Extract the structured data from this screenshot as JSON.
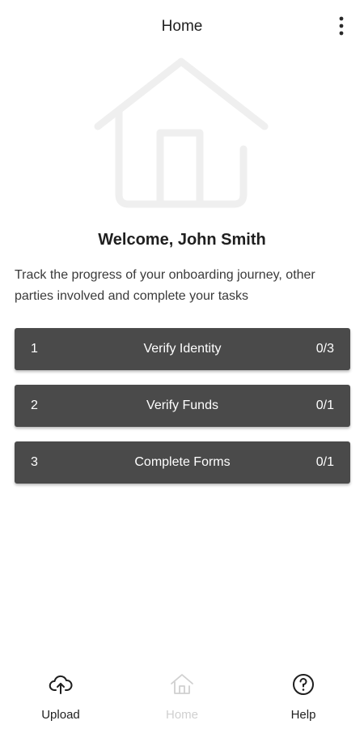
{
  "app_bar": {
    "title": "Home",
    "more_icon": "more-vertical-icon"
  },
  "hero": {
    "icon": "house-outline-icon"
  },
  "welcome": {
    "heading": "Welcome, John Smith",
    "intro": "Track the progress of your onboarding journey, other parties involved and complete your tasks"
  },
  "steps": [
    {
      "number": "1",
      "label": "Verify Identity",
      "count": "0/3"
    },
    {
      "number": "2",
      "label": "Verify Funds",
      "count": "0/1"
    },
    {
      "number": "3",
      "label": "Complete Forms",
      "count": "0/1"
    }
  ],
  "bottom_nav": [
    {
      "label": "Upload",
      "icon": "cloud-upload-icon"
    },
    {
      "label": "Home",
      "icon": "home-icon"
    },
    {
      "label": "Help",
      "icon": "help-circle-icon"
    }
  ],
  "colors": {
    "step_background": "#4a4a4a",
    "step_text": "#ffffff",
    "hero_stroke": "#efefef",
    "disabled_nav": "#d0d0d0"
  }
}
